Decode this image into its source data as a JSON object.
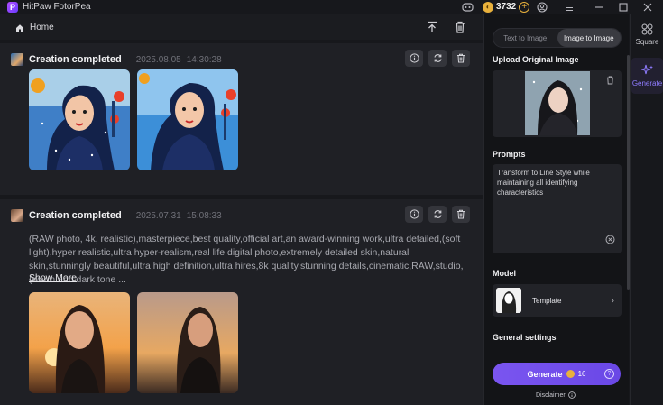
{
  "app": {
    "title": "HitPaw FotorPea",
    "logo_letter": "P"
  },
  "titlebar": {
    "credits": "3732",
    "icons": [
      "discord-icon",
      "coin-icon",
      "plus-icon",
      "user-icon",
      "menu-icon",
      "minimize-icon",
      "maximize-icon",
      "close-icon"
    ]
  },
  "topbar": {
    "home_label": "Home"
  },
  "cards": [
    {
      "title": "Creation completed",
      "date": "2025.08.05",
      "time": "14:30:28"
    },
    {
      "title": "Creation completed",
      "date": "2025.07.31",
      "time": "15:08:33",
      "prompt": "(RAW photo, 4k, realistic),masterpiece,best quality,official art,an award-winning work,ultra detailed,(soft light),hyper realistic,ultra hyper-realism,real life digital photo,extremely detailed skin,natural skin,stunningly beautiful,ultra high definition,ultra hires,8k quality,stunning details,cinematic,RAW,studio,(warm and dark tone ...",
      "show_more": "Show More"
    }
  ],
  "panel": {
    "tabs": [
      "Text to Image",
      "Image to Image"
    ],
    "active_tab": "Image to Image",
    "upload_title": "Upload Original Image",
    "prompts_title": "Prompts",
    "prompt_value": "Transform to Line Style while maintaining all identifying characteristics",
    "model_title": "Model",
    "model_name": "Template",
    "general_title": "General settings",
    "generate_label": "Generate",
    "generate_cost": "16",
    "disclaimer": "Disclaimer"
  },
  "rail": {
    "square_label": "Square",
    "generate_label": "Generate"
  },
  "colors": {
    "accent": "#7a55f0",
    "coin": "#e9b13c",
    "bg": "#17181c",
    "card": "#1f2025"
  }
}
